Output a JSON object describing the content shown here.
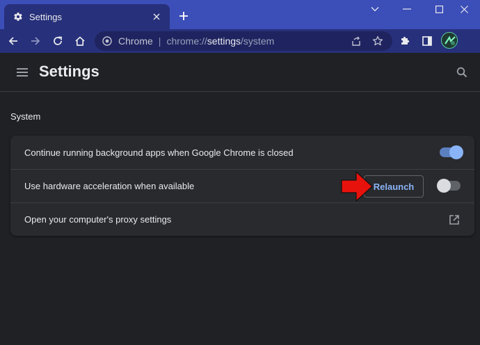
{
  "tab": {
    "title": "Settings"
  },
  "omnibox": {
    "origin": "Chrome",
    "separator": "|",
    "url_prefix": "chrome://",
    "url_host": "settings",
    "url_path": "/system"
  },
  "header": {
    "title": "Settings"
  },
  "section": {
    "title": "System"
  },
  "rows": [
    {
      "label": "Continue running background apps when Google Chrome is closed",
      "toggle_on": true
    },
    {
      "label": "Use hardware acceleration when available",
      "toggle_on": false,
      "action_label": "Relaunch"
    },
    {
      "label": "Open your computer's proxy settings"
    }
  ],
  "icons": {
    "tab": "gear-icon",
    "close": "close-icon",
    "new_tab": "plus-icon",
    "back": "back-arrow-icon",
    "forward": "forward-arrow-icon",
    "reload": "reload-icon",
    "home": "home-icon",
    "site_info": "chrome-logo-icon",
    "share": "share-icon",
    "bookmark": "star-icon",
    "extensions": "puzzle-icon",
    "side_panel": "side-panel-icon",
    "menu": "hamburger-menu-icon",
    "search": "search-icon",
    "external": "external-link-icon",
    "annotation": "red-arrow-icon"
  },
  "colors": {
    "title_bar": "#3c4eb8",
    "toolbar": "#27307a",
    "page_bg": "#202124",
    "card_bg": "#292a2d",
    "accent": "#8ab4f8",
    "annotation": "#e8120c"
  }
}
